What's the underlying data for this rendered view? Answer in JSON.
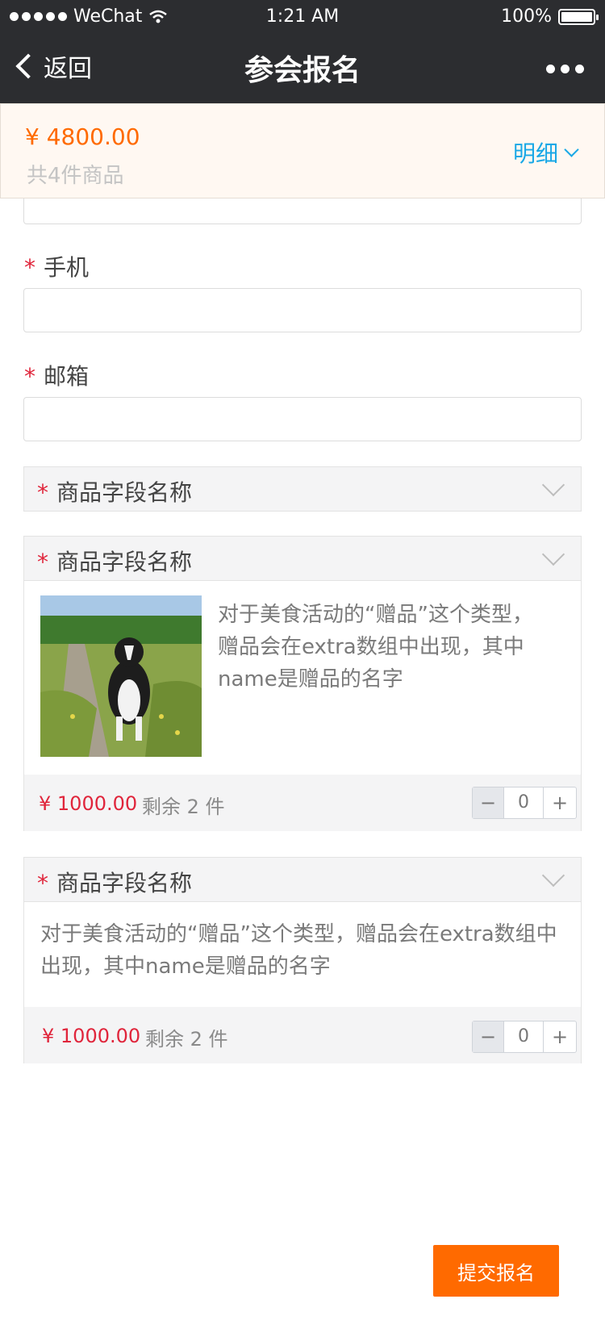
{
  "status_bar": {
    "carrier": "WeChat",
    "time": "1:21 AM",
    "battery": "100%"
  },
  "nav": {
    "back_label": "返回",
    "title": "参会报名"
  },
  "summary": {
    "price": "¥ 4800.00",
    "count": "共4件商品",
    "detail_label": "明细"
  },
  "form": {
    "phone_label": "手机",
    "email_label": "邮箱",
    "required_mark": "*"
  },
  "products": [
    {
      "field_label": "商品字段名称"
    },
    {
      "field_label": "商品字段名称",
      "description": "对于美食活动的“赠品”这个类型，赠品会在extra数组中出现，其中name是赠品的名字",
      "price": "¥ 1000.00",
      "remaining": "剩余 2 件",
      "quantity": "0"
    },
    {
      "field_label": "商品字段名称",
      "description": "对于美食活动的“赠品”这个类型，赠品会在extra数组中出现，其中name是赠品的名字",
      "price": "¥ 1000.00",
      "remaining": "剩余 2 件",
      "quantity": "0"
    }
  ],
  "stepper": {
    "minus": "−",
    "plus": "+"
  },
  "submit_label": "提交报名",
  "colors": {
    "accent": "#ff6a00",
    "link": "#19a8e6",
    "required": "#e0253b",
    "nav_bg": "#2c2d30"
  }
}
